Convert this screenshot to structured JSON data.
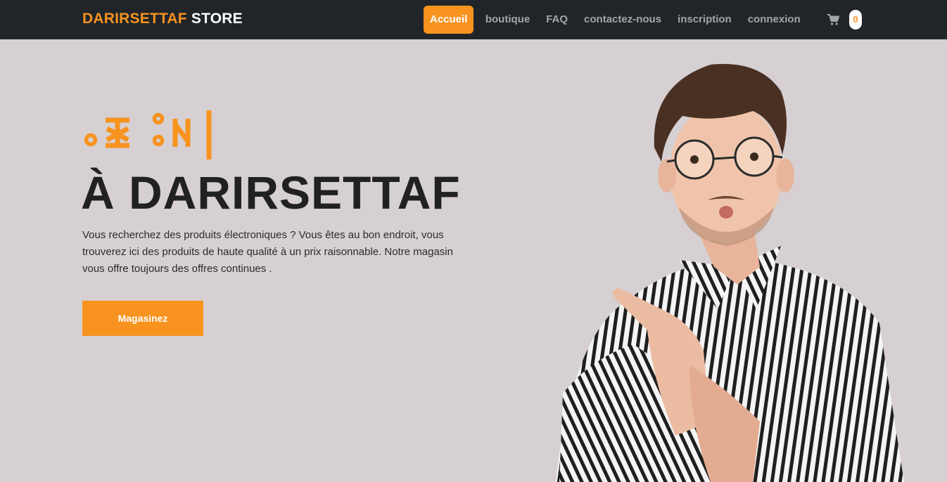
{
  "navbar": {
    "brand_part1": "DARIRSETTAF",
    "brand_part2": "STORE",
    "links": [
      {
        "label": "Accueil",
        "active": true
      },
      {
        "label": "boutique"
      },
      {
        "label": "FAQ"
      },
      {
        "label": "contactez-nous"
      },
      {
        "label": "inscription"
      },
      {
        "label": "connexion"
      }
    ],
    "cart_icon": "shopping-cart-icon",
    "cart_count": "0"
  },
  "hero": {
    "tifinagh_logo": "ⴰⵣⵓⵍ",
    "title": "À DARIRSETTAF",
    "text": "Vous recherchez des produits électroniques ? Vous êtes au bon endroit, vous trouverez ici des produits de haute qualité à un prix raisonnable. Notre magasin vous offre toujours des offres continues .",
    "cta_label": "Magasinez",
    "image": "man-pointing-photo"
  },
  "colors": {
    "accent": "#f7931e",
    "navbar_bg": "#212529",
    "hero_bg": "#d6d0d2",
    "nav_text": "#a3a5a8"
  }
}
